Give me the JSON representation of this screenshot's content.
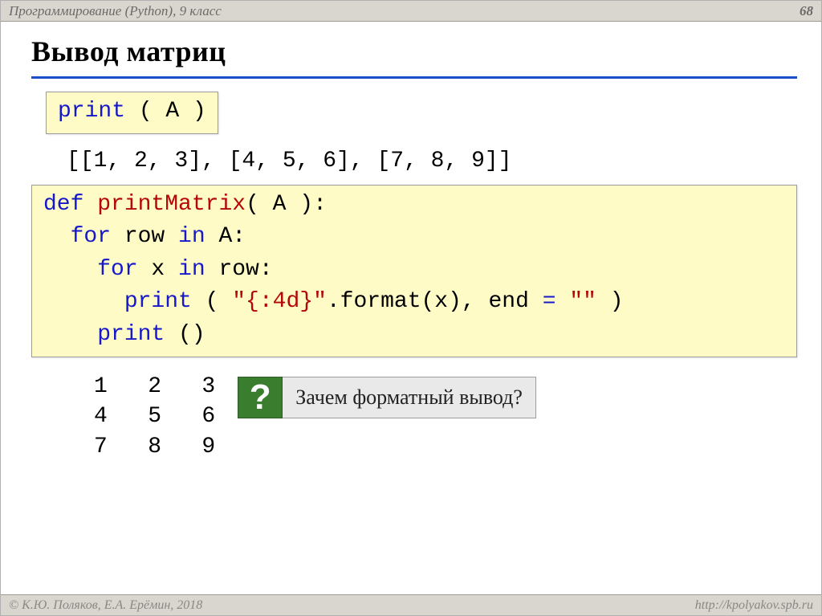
{
  "header": {
    "course": "Программирование (Python), 9 класс",
    "page": "68"
  },
  "title": "Вывод матриц",
  "code1": {
    "print": "print",
    "argA": " ( A )"
  },
  "plain_output": "[[1, 2, 3], [4, 5, 6], [7, 8, 9]]",
  "code2": {
    "l1a": "def ",
    "l1b": "printMatrix",
    "l1c": "( A ):",
    "l2a": "  for ",
    "l2b": "row",
    "l2c": " in ",
    "l2d": "A:",
    "l3a": "    for ",
    "l3b": "x",
    "l3c": " in ",
    "l3d": "row:",
    "l4a": "      print ",
    "l4b": "( ",
    "l4c": "\"{:4d}\"",
    "l4d": ".format(x), end",
    "l4e": " = ",
    "l4f": "\"\"",
    "l4g": " )",
    "l5a": "    print ",
    "l5b": "()"
  },
  "matrix_out": "1   2   3\n4   5   6\n7   8   9",
  "callout": {
    "mark": "?",
    "text": "Зачем форматный вывод?"
  },
  "footer": {
    "copyright": "© К.Ю. Поляков, Е.А. Ерёмин, 2018",
    "url": "http://kpolyakov.spb.ru"
  }
}
